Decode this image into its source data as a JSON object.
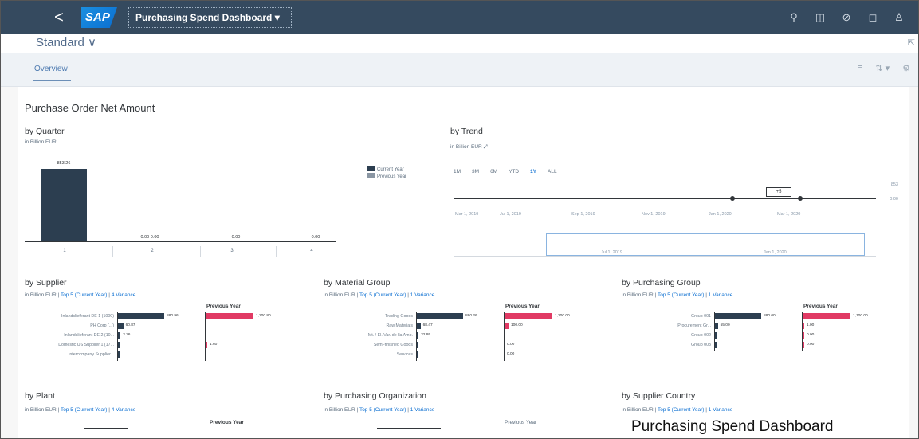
{
  "shell": {
    "back": "<",
    "logo": "SAP",
    "title": "Purchasing Spend Dashboard ▾",
    "actions": [
      "search-icon",
      "bell-icon",
      "help-icon",
      "notification-icon",
      "user-icon"
    ]
  },
  "variant": {
    "name": "Standard ∨",
    "share_icon": "share-icon"
  },
  "tabs": {
    "overview": "Overview",
    "tools": [
      "≡",
      "⇅ ▾",
      "⚙"
    ]
  },
  "section_title": "Purchase Order Net Amount",
  "colors": {
    "current": "#2c3e50",
    "previous": "#e13a64",
    "accent": "#0a6ed1",
    "shell": "#354a5f"
  },
  "by_quarter": {
    "title": "by Quarter",
    "subtitle": "in Billion EUR",
    "legend": [
      "Current Year",
      "Previous Year"
    ],
    "chart_data": {
      "type": "bar",
      "categories": [
        "1",
        "2",
        "3",
        "4"
      ],
      "series": [
        {
          "name": "Current Year",
          "values": [
            853.26,
            0.0,
            0.0,
            0.0
          ]
        }
      ],
      "value_labels": [
        "853.26",
        "0.00 0.00",
        "0.00",
        "0.00"
      ]
    }
  },
  "by_trend": {
    "title": "by Trend",
    "subtitle": "in Billion EUR",
    "periods": [
      "1M",
      "3M",
      "6M",
      "YTD",
      "1Y",
      "ALL"
    ],
    "selected_period": "1Y",
    "y_labels": [
      "853",
      "0.00"
    ],
    "dates": [
      "Mar 1, 2019",
      "Jul 1, 2019",
      "Sep 1, 2019",
      "Nov 1, 2019",
      "Jan 1, 2020",
      "Mar 1, 2020"
    ],
    "range_dates": [
      "Jul 1, 2019",
      "Jan 1, 2020"
    ],
    "tooltip": "+5"
  },
  "groups": [
    {
      "key": "supplier",
      "title": "by Supplier",
      "subtitle_prefix": "in Billion EUR",
      "links": [
        "Top 5 (Current Year)",
        "4 Variance"
      ],
      "previous_label": "Previous Year",
      "rows": [
        "Inlandslieferant DE 1 (1000)",
        "PH Corp (...)",
        "Inlandslieferant DE 2 (10...",
        "Domestic US Supplier 1 (17...",
        "Intercompany Supplier..."
      ],
      "current": [
        60.5,
        6.87,
        3.26,
        0.5,
        0.2
      ],
      "current_labels": [
        "880.96",
        "60.87",
        "3.26",
        "",
        ""
      ],
      "previous": [
        1000.8,
        0,
        0,
        1.6,
        0
      ],
      "previous_labels": [
        "1,200.80",
        "",
        "",
        "1.60",
        ""
      ]
    },
    {
      "key": "material",
      "title": "by Material Group",
      "subtitle_prefix": "in Billion EUR",
      "links": [
        "Top 5 (Current Year)",
        "1 Variance"
      ],
      "previous_label": "Previous Year",
      "rows": [
        "Trading Goods",
        "Raw Materials",
        "Mt. / El. Var. de lla Amb.",
        "Semi-finished Goods",
        "Services"
      ],
      "current": [
        880.2,
        70.26,
        32.0,
        0.5,
        0.2
      ],
      "current_labels": [
        "880.26",
        "68.47",
        "32.95",
        "",
        ""
      ],
      "previous": [
        1200.0,
        100.0,
        0,
        0,
        0
      ],
      "previous_labels": [
        "1,200.00",
        "100.00",
        "",
        "0.00",
        "0.00"
      ]
    },
    {
      "key": "purchasing_group",
      "title": "by Purchasing Group",
      "subtitle_prefix": "in Billion EUR",
      "links": [
        "Top 5 (Current Year)",
        "1 Variance"
      ],
      "previous_label": "Previous Year",
      "rows": [
        "Group 001",
        "Procurement Gr...",
        "Group 002",
        "Group 003"
      ],
      "current": [
        880.0,
        55.0,
        8.0,
        3.0
      ],
      "current_labels": [
        "880.00",
        "55.00",
        "",
        ""
      ],
      "previous": [
        1100.0,
        20.0,
        15.0,
        5.0
      ],
      "previous_labels": [
        "1,100.00",
        "1.00",
        "0.00",
        "0.00"
      ]
    }
  ],
  "lower": [
    {
      "title": "by Plant",
      "subtitle": "in Billion EUR",
      "links": [
        "Top 5 (Current Year)",
        "4 Variance"
      ],
      "previous_label": "Previous Year"
    },
    {
      "title": "by Purchasing Organization",
      "subtitle": "in Billion EUR",
      "links": [
        "Top 5 (Current Year)",
        "1 Variance"
      ],
      "previous_label": "Previous Year"
    },
    {
      "title": "by Supplier Country",
      "subtitle": "in Billion EUR",
      "links": [
        "Top 5 (Current Year)",
        "1 Variance"
      ],
      "previous_label": ""
    }
  ],
  "caption": "Purchasing Spend Dashboard"
}
